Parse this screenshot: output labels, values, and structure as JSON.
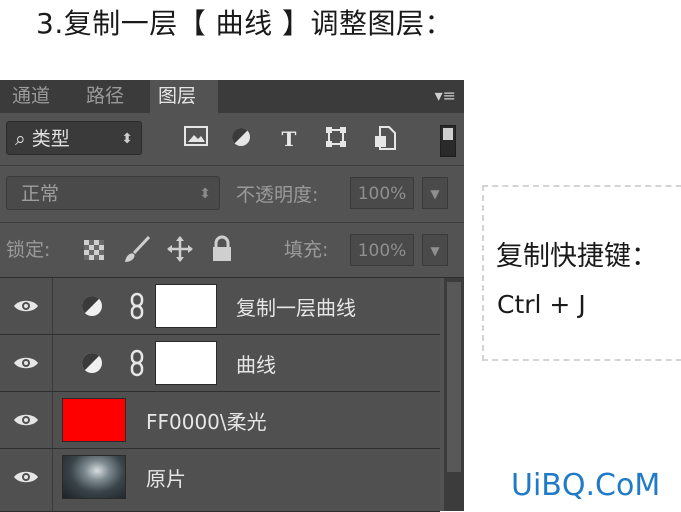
{
  "title": "3.复制一层【 曲线 】调整图层：",
  "panel": {
    "tabs": [
      {
        "label": "通道"
      },
      {
        "label": "路径"
      },
      {
        "label": "图层"
      }
    ],
    "menu_icon": "panel-menu-icon",
    "filter": {
      "kind_label": "类型",
      "icons": [
        "image-filter-icon",
        "adjustment-filter-icon",
        "type-filter-icon",
        "shape-filter-icon",
        "smart-object-filter-icon"
      ]
    },
    "blend": {
      "mode": "正常",
      "opacity_label": "不透明度:",
      "opacity_value": "100%"
    },
    "lock": {
      "label": "锁定:",
      "icons": [
        "lock-transparent-icon",
        "lock-brush-icon",
        "lock-move-icon",
        "lock-all-icon"
      ],
      "fill_label": "填充:",
      "fill_value": "100%"
    },
    "layers": [
      {
        "name": "复制一层曲线",
        "type": "adjustment"
      },
      {
        "name": "曲线",
        "type": "adjustment"
      },
      {
        "name": "FF0000\\柔光",
        "type": "fill",
        "color": "#ff0000"
      },
      {
        "name": "原片",
        "type": "photo"
      }
    ]
  },
  "note": {
    "title": "复制快捷键：",
    "keys": "Ctrl + J"
  },
  "watermark": "UiBQ.CoM"
}
